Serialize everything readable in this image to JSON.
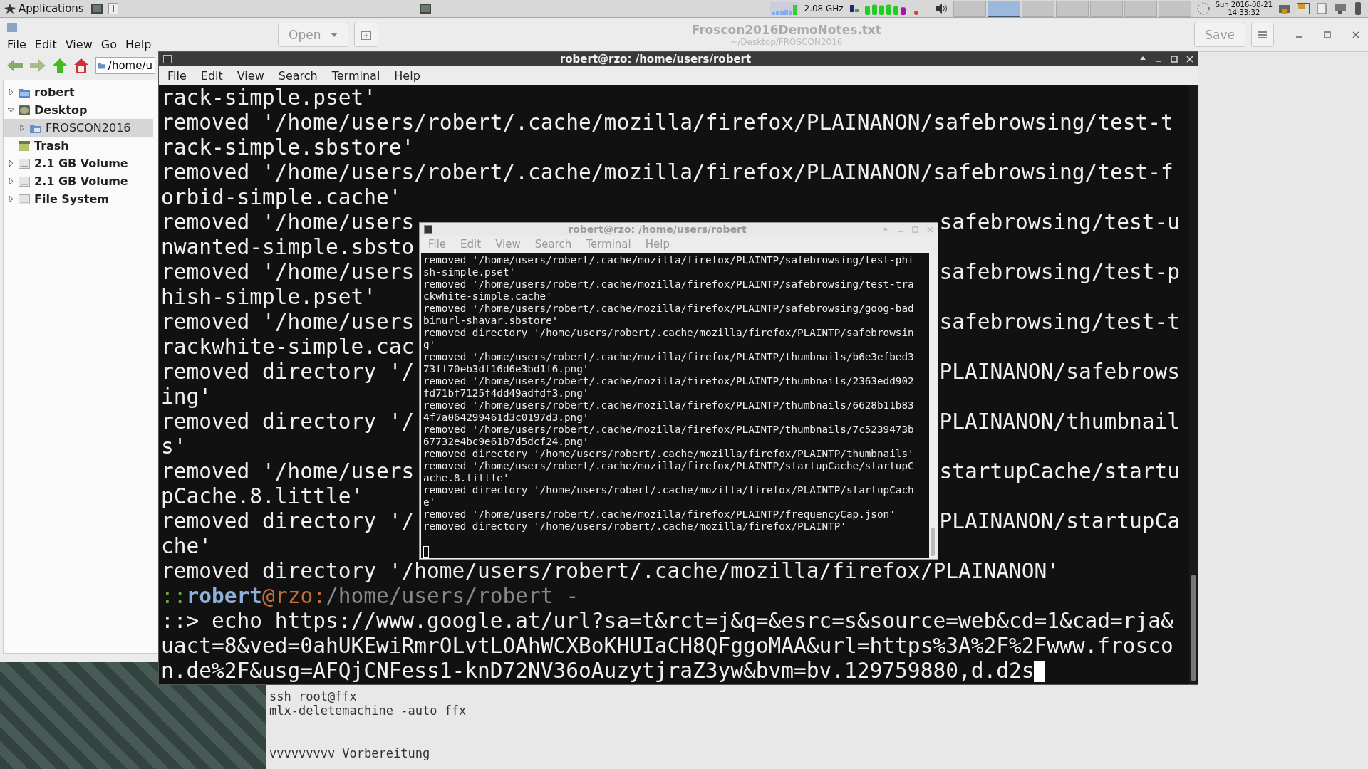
{
  "top_panel": {
    "menu": "Applications",
    "cpu_freq": "2.08 GHz",
    "date": "Sun 2016-08-21",
    "time": "14:33:32"
  },
  "file_manager": {
    "menu": [
      "File",
      "Edit",
      "View",
      "Go",
      "Help"
    ],
    "path": "/home/u",
    "tree": [
      {
        "label": "robert",
        "expanded": false,
        "selected": false,
        "kind": "home"
      },
      {
        "label": "Desktop",
        "expanded": true,
        "selected": false,
        "kind": "desktop",
        "children": [
          {
            "label": "FROSCON2016",
            "expanded": false,
            "selected": true,
            "kind": "folder"
          }
        ]
      },
      {
        "label": "Trash",
        "selected": false,
        "kind": "trash"
      },
      {
        "label": "2.1 GB Volume",
        "expanded": false,
        "selected": false,
        "kind": "drive"
      },
      {
        "label": "2.1 GB Volume",
        "expanded": false,
        "selected": false,
        "kind": "drive"
      },
      {
        "label": "File System",
        "expanded": false,
        "selected": false,
        "kind": "drive"
      }
    ]
  },
  "text_editor": {
    "open_button": "Open",
    "title": "Froscon2016DemoNotes.txt",
    "subtitle": "~/Desktop/FROSCON2016",
    "save_button": "Save",
    "lines": [
      "ssh root@ffx",
      "mlx-deletemachine -auto ffx",
      "vvvvvvvvv Vorbereitung"
    ]
  },
  "big_terminal": {
    "title": "robert@rzo: /home/users/robert",
    "menu": [
      "File",
      "Edit",
      "View",
      "Search",
      "Terminal",
      "Help"
    ],
    "lines": [
      {
        "left": "rack-simple.pset'"
      },
      {
        "left": "removed '/home/users/robert/.cache/mozilla/firefox/PLAINANON/safebrowsing/test-t"
      },
      {
        "left": "rack-simple.sbstore'"
      },
      {
        "left": "removed '/home/users/robert/.cache/mozilla/firefox/PLAINANON/safebrowsing/test-f"
      },
      {
        "left": "orbid-simple.cache'"
      },
      {
        "left": "removed '/home/users",
        "right": "safebrowsing/test-u"
      },
      {
        "left": "nwanted-simple.sbsto"
      },
      {
        "left": "removed '/home/users",
        "right": "safebrowsing/test-p"
      },
      {
        "left": "hish-simple.pset'"
      },
      {
        "left": "removed '/home/users",
        "right": "safebrowsing/test-t"
      },
      {
        "left": "rackwhite-simple.cac"
      },
      {
        "left": "removed directory '/",
        "right": "PLAINANON/safebrows"
      },
      {
        "left": "ing'"
      },
      {
        "left": "removed directory '/",
        "right": "PLAINANON/thumbnail"
      },
      {
        "left": "s'"
      },
      {
        "left": "removed '/home/users",
        "right": "startupCache/startu"
      },
      {
        "left": "pCache.8.little'"
      },
      {
        "left": "removed directory '/",
        "right": "PLAINANON/startupCa"
      },
      {
        "left": "che'"
      },
      {
        "left": "removed directory '/home/users/robert/.cache/mozilla/firefox/PLAINANON'"
      }
    ],
    "prompt": [
      {
        "kind": "punct",
        "text": "::"
      },
      {
        "kind": "user",
        "text": "robert"
      },
      {
        "kind": "at",
        "text": "@"
      },
      {
        "kind": "host",
        "text": "rzo"
      },
      {
        "kind": "at",
        "text": ":"
      },
      {
        "kind": "path",
        "text": "/home/users/robert -"
      }
    ],
    "command_lines": [
      "::> echo https://www.google.at/url?sa=t&rct=j&q=&esrc=s&source=web&cd=1&cad=rja&",
      "uact=8&ved=0ahUKEwiRmrOLvtLOAhWCXBoKHUIaCH8QFggoMAA&url=https%3A%2F%2Fwww.frosco",
      "n.de%2F&usg=AFQjCNFess1-knD72NV36oAuzytjraZ3yw&bvm=bv.129759880,d.d2s"
    ]
  },
  "small_terminal": {
    "title": "robert@rzo: /home/users/robert",
    "menu": [
      "File",
      "Edit",
      "View",
      "Search",
      "Terminal",
      "Help"
    ],
    "lines": [
      "removed '/home/users/robert/.cache/mozilla/firefox/PLAINTP/safebrowsing/test-phi",
      "sh-simple.pset'",
      "removed '/home/users/robert/.cache/mozilla/firefox/PLAINTP/safebrowsing/test-tra",
      "ckwhite-simple.cache'",
      "removed '/home/users/robert/.cache/mozilla/firefox/PLAINTP/safebrowsing/goog-bad",
      "binurl-shavar.sbstore'",
      "removed directory '/home/users/robert/.cache/mozilla/firefox/PLAINTP/safebrowsin",
      "g'",
      "removed '/home/users/robert/.cache/mozilla/firefox/PLAINTP/thumbnails/b6e3efbed3",
      "73ff70eb3df16d6e3bd1f6.png'",
      "removed '/home/users/robert/.cache/mozilla/firefox/PLAINTP/thumbnails/2363edd902",
      "fd71bf7125f4dd49adfdf3.png'",
      "removed '/home/users/robert/.cache/mozilla/firefox/PLAINTP/thumbnails/6628b11b83",
      "4f7a064299461d3c0197d3.png'",
      "removed '/home/users/robert/.cache/mozilla/firefox/PLAINTP/thumbnails/7c5239473b",
      "67732e4bc9e61b7d5dcf24.png'",
      "removed directory '/home/users/robert/.cache/mozilla/firefox/PLAINTP/thumbnails'",
      "removed '/home/users/robert/.cache/mozilla/firefox/PLAINTP/startupCache/startupC",
      "ache.8.little'",
      "removed directory '/home/users/robert/.cache/mozilla/firefox/PLAINTP/startupCach",
      "e'",
      "removed '/home/users/robert/.cache/mozilla/firefox/PLAINTP/frequencyCap.json'",
      "removed directory '/home/users/robert/.cache/mozilla/firefox/PLAINTP'"
    ]
  }
}
